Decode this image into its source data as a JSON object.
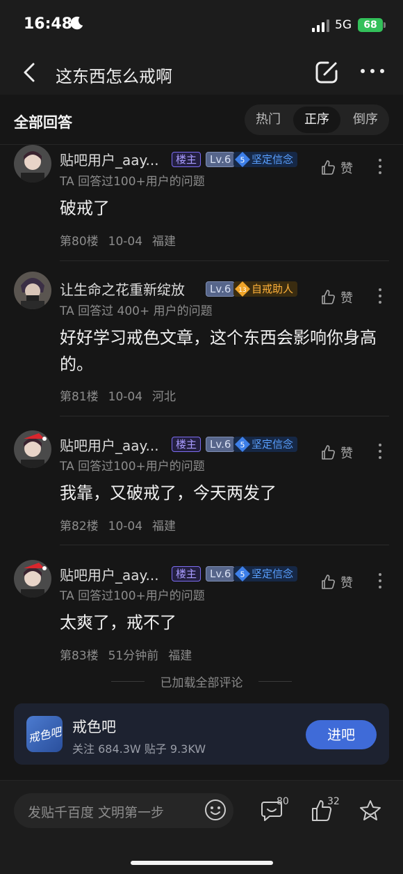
{
  "status_bar": {
    "time": "16:48",
    "network": "5G",
    "battery": "68"
  },
  "nav": {
    "title": "这东西怎么戒啊"
  },
  "section": {
    "heading": "全部回答",
    "sort_tabs": [
      "热门",
      "正序",
      "倒序"
    ],
    "active_sort": "正序"
  },
  "comments": [
    {
      "user": "贴吧用户_aay...",
      "is_host": true,
      "host_label": "楼主",
      "level": "Lv.6",
      "title_level": "5",
      "title": "坚定信念",
      "answered": "TA 回答过100+用户的问题",
      "body": "破戒了",
      "floor": "第80楼",
      "date": "10-04",
      "location": "福建",
      "like_label": "赞"
    },
    {
      "user": "让生命之花重新绽放",
      "is_host": false,
      "level": "Lv.6",
      "title_level": "13",
      "title": "自戒助人",
      "answered": "TA 回答过 400+ 用户的问题",
      "body": "好好学习戒色文章，这个东西会影响你身高的。",
      "floor": "第81楼",
      "date": "10-04",
      "location": "河北",
      "like_label": "赞"
    },
    {
      "user": "贴吧用户_aay...",
      "is_host": true,
      "host_label": "楼主",
      "level": "Lv.6",
      "title_level": "5",
      "title": "坚定信念",
      "answered": "TA 回答过100+用户的问题",
      "body": "我靠，又破戒了，今天两发了",
      "floor": "第82楼",
      "date": "10-04",
      "location": "福建",
      "like_label": "赞"
    },
    {
      "user": "贴吧用户_aay...",
      "is_host": true,
      "host_label": "楼主",
      "level": "Lv.6",
      "title_level": "5",
      "title": "坚定信念",
      "answered": "TA 回答过100+用户的问题",
      "body": "太爽了，戒不了",
      "floor": "第83楼",
      "date": "51分钟前",
      "location": "福建",
      "like_label": "赞"
    }
  ],
  "loaded_all": "已加载全部评论",
  "forum": {
    "logo_text": "戒色吧",
    "name": "戒色吧",
    "stats": "关注 684.3W  贴子 9.3KW",
    "join_label": "进吧"
  },
  "bottom_bar": {
    "placeholder": "发贴千百度 文明第一步",
    "comment_count": "80",
    "like_count": "32"
  }
}
